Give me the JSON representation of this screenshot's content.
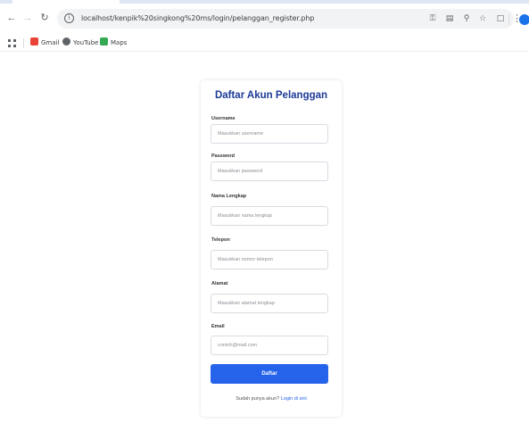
{
  "browser": {
    "url": "localhost/kenpik%20singkong%20ms/login/pelanggan_register.php",
    "bookmarks": [
      {
        "label": "Gmail",
        "icon": "gmail-icon"
      },
      {
        "label": "YouTube",
        "icon": "youtube-icon"
      },
      {
        "label": "Maps",
        "icon": "maps-icon"
      }
    ]
  },
  "form": {
    "title": "Daftar Akun Pelanggan",
    "fields": [
      {
        "label": "Username",
        "placeholder": "Masukkan username"
      },
      {
        "label": "Password",
        "placeholder": "Masukkan password"
      },
      {
        "label": "Nama Lengkap",
        "placeholder": "Masukkan nama lengkap"
      },
      {
        "label": "Telepon",
        "placeholder": "Masukkan nomor telepon"
      },
      {
        "label": "Alamat",
        "placeholder": "Masukkan alamat lengkap"
      },
      {
        "label": "Email",
        "placeholder": "contoh@mail.com"
      }
    ],
    "submit_label": "Daftar",
    "footer_text": "Sudah punya akun?",
    "footer_link": "Login di sini"
  },
  "colors": {
    "title": "#1c3a97",
    "button": "#2563eb",
    "link": "#2563eb"
  }
}
